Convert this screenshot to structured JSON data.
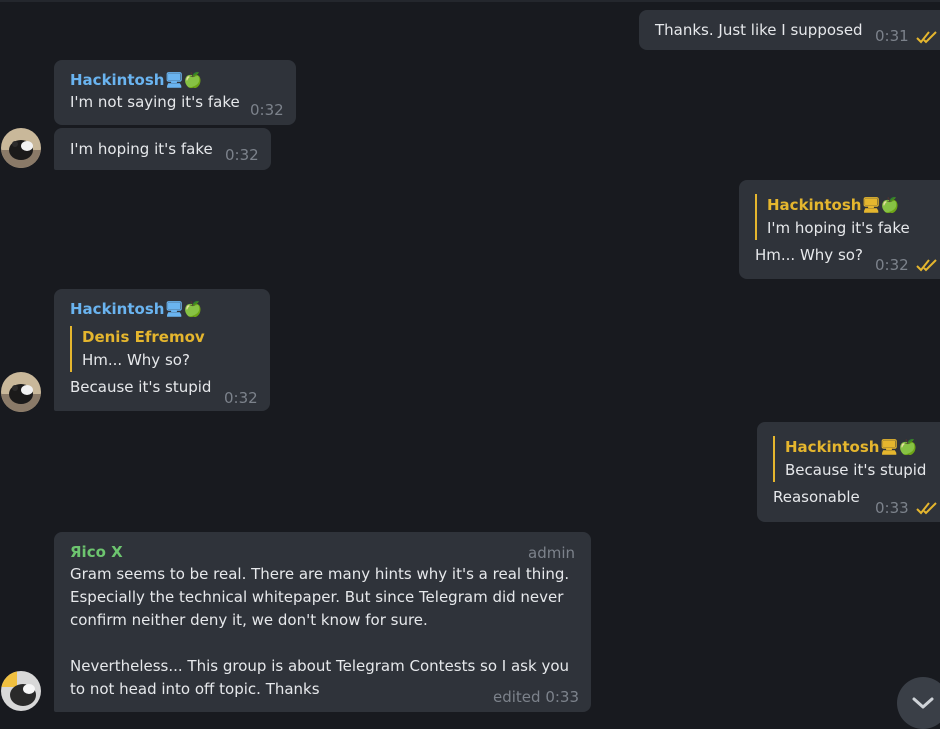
{
  "messages": [
    {
      "id": "m1",
      "text": "Thanks. Just like I supposed",
      "time": "0:31"
    },
    {
      "id": "m2",
      "sender": "Hackintosh🖥🍏",
      "text": "I'm not saying it's fake",
      "time": "0:32"
    },
    {
      "id": "m3",
      "text": "I'm hoping it's fake",
      "time": "0:32"
    },
    {
      "id": "m4",
      "reply_name": "Hackintosh🖥🍏",
      "reply_text": "I'm hoping it's fake",
      "text": "Hm... Why so?",
      "time": "0:32"
    },
    {
      "id": "m5",
      "sender": "Hackintosh🖥🍏",
      "reply_name": "Denis Efremov",
      "reply_text": "Hm... Why so?",
      "text": "Because it's stupid",
      "time": "0:32"
    },
    {
      "id": "m6",
      "reply_name": "Hackintosh🖥🍏",
      "reply_text": "Because it's stupid",
      "text": "Reasonable",
      "time": "0:33"
    },
    {
      "id": "m7",
      "sender": "Яico X",
      "badge": "admin",
      "text": "Gram seems to be real. There are many hints why it's a real thing.\nEspecially the technical whitepaper. But since Telegram did never\nconfirm neither deny it, we don't know for sure.\n\nNevertheless... This group is about Telegram Contests so I ask you\nto not head into off topic. Thanks",
      "time": "edited 0:33"
    }
  ],
  "colors": {
    "background": "#181a1f",
    "bubble": "#2f333a",
    "sender_blue": "#6ab4f0",
    "sender_green": "#6dc56f",
    "reply_accent": "#e5b62e",
    "time": "#7c828b",
    "read_checks": "#e5b62e"
  },
  "icons": {
    "read_status": "double-check-icon",
    "scroll_down": "chevron-down-icon",
    "avatar": "user-avatar"
  }
}
